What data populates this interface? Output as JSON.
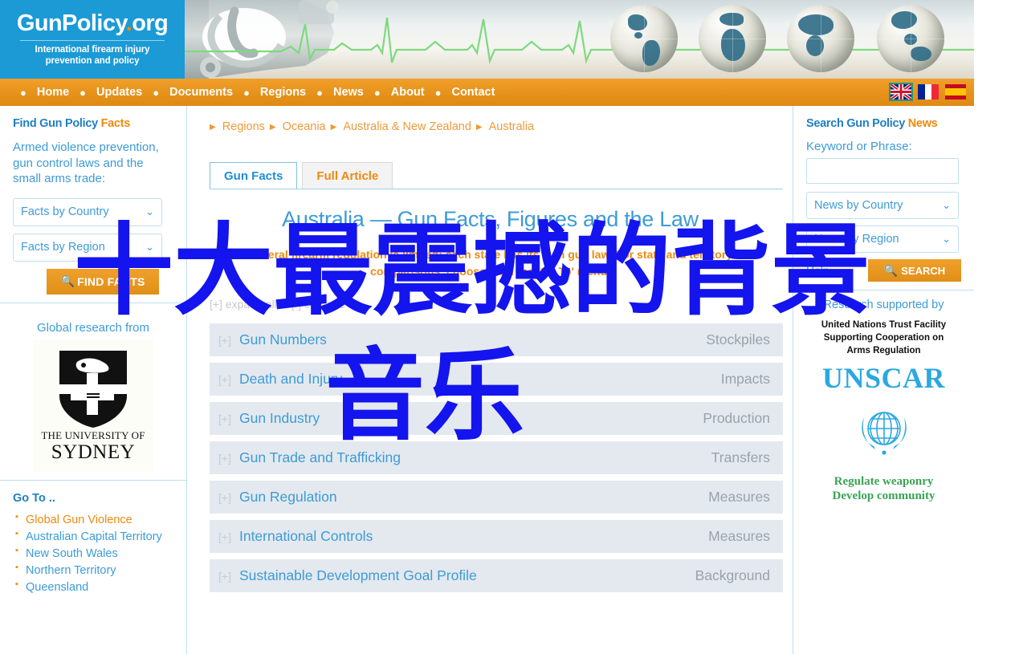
{
  "site": {
    "logo_main": "GunPolicy",
    "logo_dot": ".",
    "logo_tld": "org",
    "tagline_line1": "International firearm injury",
    "tagline_line2": "prevention and policy",
    "brand_blue": "#1b9ad6",
    "brand_orange": "#ee8a0e"
  },
  "nav": {
    "items": [
      {
        "label": "Home"
      },
      {
        "label": "Updates"
      },
      {
        "label": "Documents"
      },
      {
        "label": "Regions"
      },
      {
        "label": "News"
      },
      {
        "label": "About"
      },
      {
        "label": "Contact"
      }
    ],
    "flags": [
      {
        "name": "flag-uk",
        "label": "English"
      },
      {
        "name": "flag-fr",
        "label": "Français"
      },
      {
        "name": "flag-es",
        "label": "Español"
      }
    ]
  },
  "left_sidebar": {
    "find_facts": {
      "title_main": "Find Gun Policy ",
      "title_accent": "Facts",
      "description": "Armed violence prevention, gun control laws and the small arms trade:",
      "select_country": "Facts by Country",
      "select_region": "Facts by Region",
      "button": "FIND FACTS"
    },
    "research": {
      "label": "Global research from",
      "university_line1": "THE UNIVERSITY OF",
      "university_line2": "SYDNEY"
    },
    "goto": {
      "title": "Go To ..",
      "items": [
        {
          "label": "Global Gun Violence",
          "highlight": true
        },
        {
          "label": "Australian Capital Territory",
          "highlight": false
        },
        {
          "label": "New South Wales",
          "highlight": false
        },
        {
          "label": "Northern Territory",
          "highlight": false
        },
        {
          "label": "Queensland",
          "highlight": false
        }
      ]
    }
  },
  "main": {
    "breadcrumb": [
      "Regions",
      "Oceania",
      "Australia & New Zealand",
      "Australia"
    ],
    "tabs": [
      {
        "label": "Gun Facts",
        "active": true
      },
      {
        "label": "Full Article",
        "active": false
      }
    ],
    "page_title": "Australia — Gun Facts, Figures and the Law",
    "lede": "Federal firearm regulation is limited: each state has its own gun law. For state and territory comparisons, choose from the 'Go To' menu.",
    "expand_all": "[+] expand all",
    "collapse_all": "[-] collapse all",
    "row_toggle": "[+]",
    "rows": [
      {
        "name": "Gun Numbers",
        "tag": "Stockpiles"
      },
      {
        "name": "Death and Injury",
        "tag": "Impacts"
      },
      {
        "name": "Gun Industry",
        "tag": "Production"
      },
      {
        "name": "Gun Trade and Trafficking",
        "tag": "Transfers"
      },
      {
        "name": "Gun Regulation",
        "tag": "Measures"
      },
      {
        "name": "International Controls",
        "tag": "Measures"
      },
      {
        "name": "Sustainable Development Goal Profile",
        "tag": "Background"
      }
    ]
  },
  "right_sidebar": {
    "search": {
      "title_main": "Search Gun Policy ",
      "title_accent": "News",
      "keyword_label": "Keyword or Phrase:",
      "keyword_value": "",
      "keyword_placeholder": "",
      "select_country": "News by Country",
      "select_region": "News by Region",
      "help_label": "Help",
      "button": "SEARCH"
    },
    "supporter": {
      "label": "Research supported by",
      "line1": "United Nations Trust Facility",
      "line2": "Supporting Cooperation on",
      "line3": "Arms Regulation",
      "acronym": "UNSCAR",
      "motto_line1": "Regulate weaponry",
      "motto_line2": "Develop community"
    }
  },
  "overlay": {
    "line1": "十大最震撼的背景",
    "line2": "音乐",
    "color": "#1414ee"
  }
}
